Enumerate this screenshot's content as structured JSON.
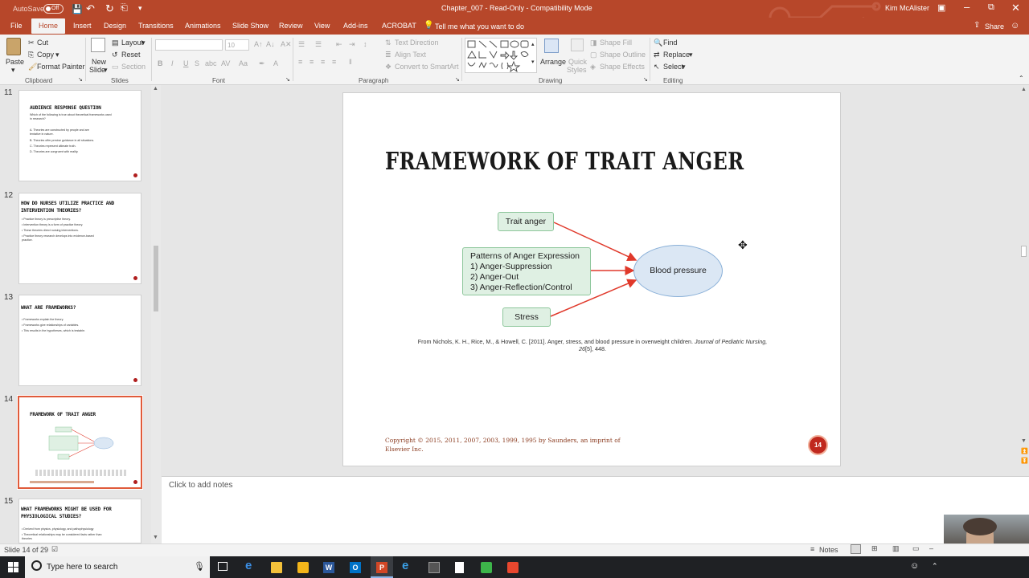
{
  "app": {
    "autosave_label": "AutoSave",
    "autosave_state": "Off",
    "document_title": "Chapter_007 - Read-Only - Compatibility Mode",
    "user_name": "Kim McAlister",
    "accent_color": "#b7472a"
  },
  "tabs": [
    "File",
    "Home",
    "Insert",
    "Design",
    "Transitions",
    "Animations",
    "Slide Show",
    "Review",
    "View",
    "Add-ins",
    "ACROBAT"
  ],
  "tell_me": "Tell me what you want to do",
  "share_label": "Share",
  "ribbon": {
    "clipboard": {
      "paste": "Paste",
      "cut": "Cut",
      "copy": "Copy",
      "format_painter": "Format Painter",
      "group": "Clipboard"
    },
    "slides": {
      "new_slide_line1": "New",
      "new_slide_line2": "Slide",
      "layout": "Layout",
      "reset": "Reset",
      "section": "Section",
      "group": "Slides"
    },
    "font": {
      "size": "10",
      "bold": "B",
      "italic": "I",
      "underline": "U",
      "strike": "S",
      "group": "Font"
    },
    "paragraph": {
      "text_direction": "Text Direction",
      "align_text": "Align Text",
      "smartart": "Convert to SmartArt",
      "group": "Paragraph"
    },
    "drawing": {
      "arrange": "Arrange",
      "quick_styles_line1": "Quick",
      "quick_styles_line2": "Styles",
      "shape_fill": "Shape Fill",
      "shape_outline": "Shape Outline",
      "shape_effects": "Shape Effects",
      "group": "Drawing"
    },
    "editing": {
      "find": "Find",
      "replace": "Replace",
      "select": "Select",
      "group": "Editing"
    }
  },
  "thumbnails": [
    {
      "num": "11",
      "title_l1": "AUDIENCE RESPONSE QUESTION",
      "title_l2": "",
      "lines": [
        "Which of the following is true about theoretical frameworks used",
        "in research?",
        "A.  Theories are constructed by people and are",
        "     tentative in nature.",
        "B.  Theories offer precise guidance in all situations.",
        "C.  Theories represent ultimate truth.",
        "D.  Theories are congruent with reality."
      ]
    },
    {
      "num": "12",
      "title_l1": "HOW DO NURSES UTILIZE PRACTICE AND",
      "title_l2": "INTERVENTION THEORIES?",
      "lines": [
        "• Practice theory is prescriptive theory.",
        "• Intervention theory is a form of practice theory.",
        "• These theories direct nursing interventions.",
        "• Practice theory research develops into evidence-based",
        "  practice."
      ]
    },
    {
      "num": "13",
      "title_l1": "WHAT ARE FRAMEWORKS?",
      "title_l2": "",
      "lines": [
        "• Frameworks explain the theory.",
        "• Frameworks give relationships of variables.",
        "• This results in the hypotheses, which is testable."
      ]
    },
    {
      "num": "14",
      "title_l1": "FRAMEWORK OF TRAIT ANGER",
      "title_l2": "",
      "lines": []
    },
    {
      "num": "15",
      "title_l1": "WHAT FRAMEWORKS MIGHT BE USED FOR",
      "title_l2": "PHYSIOLOGICAL STUDIES?",
      "lines": [
        "• Derived from physics, physiology, and pathophysiology",
        "• Theoretical relationships may be considered facts rather than",
        "  theories"
      ]
    }
  ],
  "slide": {
    "title": "FRAMEWORK OF TRAIT ANGER",
    "box_trait": "Trait anger",
    "box_patterns": [
      "Patterns of Anger Expression",
      "1) Anger-Suppression",
      "2) Anger-Out",
      "3) Anger-Reflection/Control"
    ],
    "box_stress": "Stress",
    "ellipse": "Blood pressure",
    "citation_l1": "From Nichols, K. H., Rice, M., & Howell, C. [2011]. Anger, stress, and blood pressure in overweight children.",
    "citation_journal": "Journal of Pediatric Nursing,",
    "citation_vol": "26",
    "citation_rest": "[5], 448.",
    "copyright_l1": "Copyright © 2015, 2011, 2007, 2003, 1999, 1995 by Saunders, an imprint of",
    "copyright_l2": "Elsevier Inc.",
    "page_number": "14",
    "badge_color": "#c0281e"
  },
  "notes_placeholder": "Click to add notes",
  "status": {
    "slide_of": "Slide 14 of 29",
    "notes": "Notes"
  },
  "taskbar": {
    "search": "Type here to search"
  }
}
